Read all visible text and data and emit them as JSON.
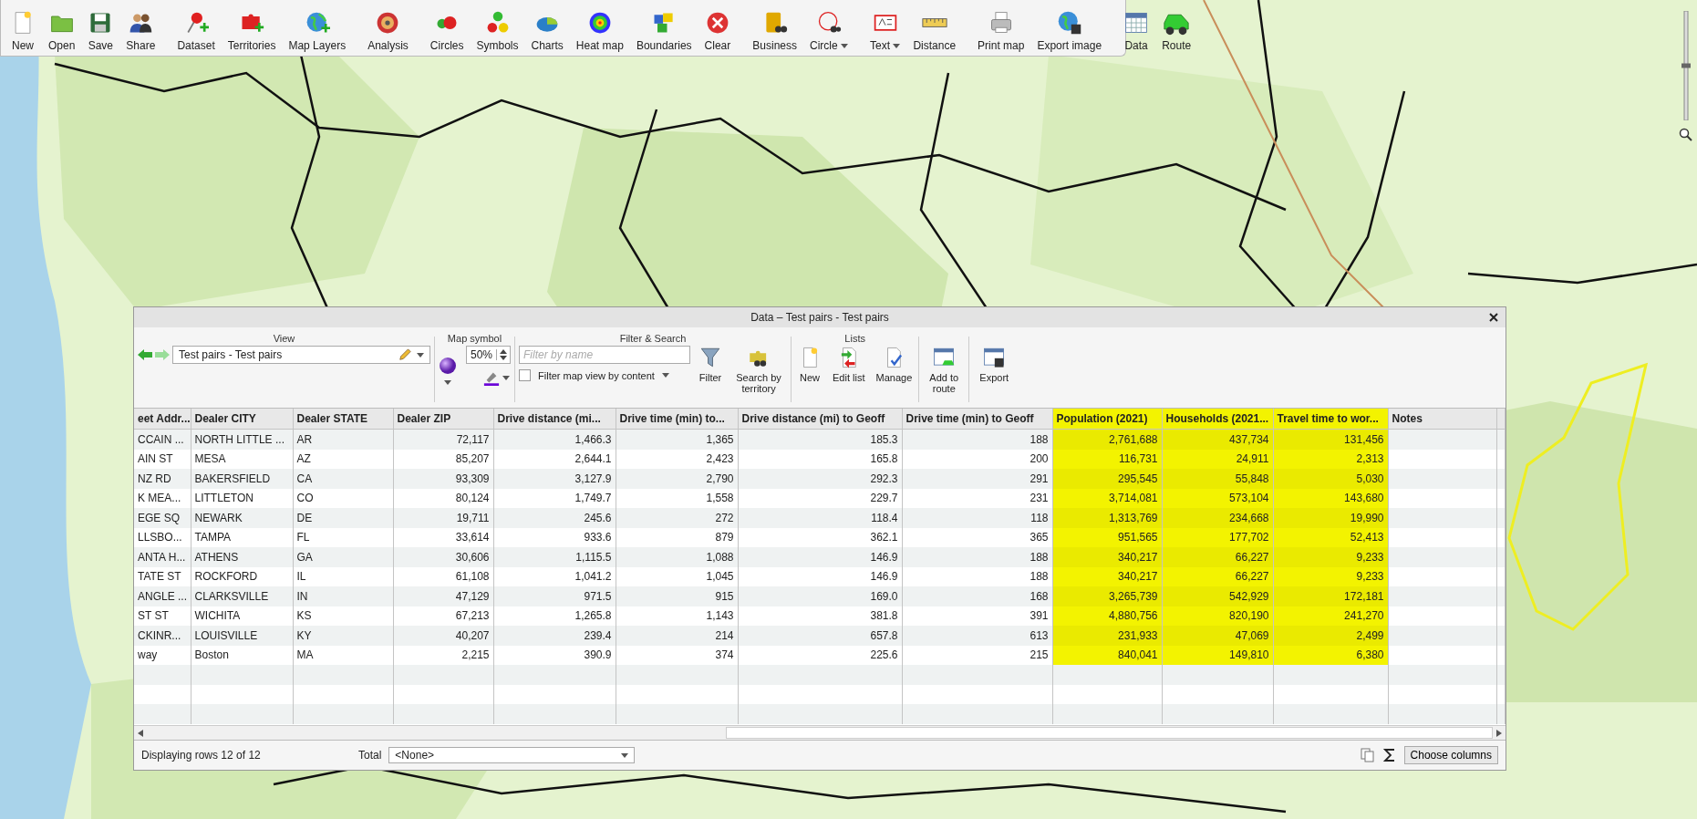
{
  "toolbar": {
    "groups": [
      {
        "buttons": [
          {
            "label": "New",
            "has_menu": false
          },
          {
            "label": "Open",
            "has_menu": false
          },
          {
            "label": "Save",
            "has_menu": false
          },
          {
            "label": "Share",
            "has_menu": false
          }
        ]
      },
      {
        "buttons": [
          {
            "label": "Dataset",
            "has_menu": false
          },
          {
            "label": "Territories",
            "has_menu": false
          },
          {
            "label": "Map Layers",
            "has_menu": false
          }
        ]
      },
      {
        "buttons": [
          {
            "label": "Analysis",
            "has_menu": false
          }
        ]
      },
      {
        "buttons": [
          {
            "label": "Circles",
            "has_menu": false
          },
          {
            "label": "Symbols",
            "has_menu": false
          },
          {
            "label": "Charts",
            "has_menu": false
          },
          {
            "label": "Heat map",
            "has_menu": false
          },
          {
            "label": "Boundaries",
            "has_menu": false
          },
          {
            "label": "Clear",
            "has_menu": false
          }
        ]
      },
      {
        "buttons": [
          {
            "label": "Business",
            "has_menu": false
          },
          {
            "label": "Circle",
            "has_menu": true
          }
        ]
      },
      {
        "buttons": [
          {
            "label": "Text",
            "has_menu": true
          },
          {
            "label": "Distance",
            "has_menu": false
          }
        ]
      },
      {
        "buttons": [
          {
            "label": "Print map",
            "has_menu": false
          },
          {
            "label": "Export image",
            "has_menu": false
          }
        ]
      },
      {
        "buttons": [
          {
            "label": "Data",
            "has_menu": false
          },
          {
            "label": "Route",
            "has_menu": false
          }
        ]
      }
    ]
  },
  "map_zoom": {
    "level": 0.5
  },
  "data_window": {
    "title": "Data – Test pairs - Test pairs",
    "view": {
      "title": "View",
      "value": "Test pairs - Test pairs"
    },
    "map_symbol": {
      "title": "Map symbol",
      "size": "50%"
    },
    "filter_search": {
      "title": "Filter & Search",
      "placeholder": "Filter by name",
      "filter_map_view": {
        "label": "Filter map view by content",
        "checked": false
      },
      "buttons": [
        "Filter",
        "Search by territory"
      ]
    },
    "lists": {
      "title": "Lists",
      "buttons": [
        "New",
        "Edit list",
        "Manage"
      ]
    },
    "buttons": [
      "Add to route",
      "Export"
    ],
    "table": {
      "columns": [
        {
          "label": "eet Addr...",
          "highlighted": false
        },
        {
          "label": "Dealer CITY",
          "highlighted": false
        },
        {
          "label": "Dealer STATE",
          "highlighted": false
        },
        {
          "label": "Dealer ZIP",
          "highlighted": false
        },
        {
          "label": "Drive distance (mi...",
          "highlighted": false
        },
        {
          "label": "Drive time (min) to...",
          "highlighted": false
        },
        {
          "label": "Drive distance (mi) to Geoff",
          "highlighted": false
        },
        {
          "label": "Drive time (min) to Geoff",
          "highlighted": false
        },
        {
          "label": "Population (2021)",
          "highlighted": true
        },
        {
          "label": "Households (2021...",
          "highlighted": true
        },
        {
          "label": "Travel time to wor...",
          "highlighted": true
        },
        {
          "label": "Notes",
          "highlighted": false
        }
      ],
      "rows": [
        [
          "CCAIN ...",
          "NORTH LITTLE ...",
          "AR",
          "72,117",
          "1,466.3",
          "1,365",
          "185.3",
          "188",
          "2,761,688",
          "437,734",
          "131,456"
        ],
        [
          "AIN ST",
          "MESA",
          "AZ",
          "85,207",
          "2,644.1",
          "2,423",
          "165.8",
          "200",
          "116,731",
          "24,911",
          "2,313"
        ],
        [
          "NZ RD",
          "BAKERSFIELD",
          "CA",
          "93,309",
          "3,127.9",
          "2,790",
          "292.3",
          "291",
          "295,545",
          "55,848",
          "5,030"
        ],
        [
          "K MEA...",
          "LITTLETON",
          "CO",
          "80,124",
          "1,749.7",
          "1,558",
          "229.7",
          "231",
          "3,714,081",
          "573,104",
          "143,680"
        ],
        [
          "EGE SQ",
          "NEWARK",
          "DE",
          "19,711",
          "245.6",
          "272",
          "118.4",
          "118",
          "1,313,769",
          "234,668",
          "19,990"
        ],
        [
          "LLSBO...",
          "TAMPA",
          "FL",
          "33,614",
          "933.6",
          "879",
          "362.1",
          "365",
          "951,565",
          "177,702",
          "52,413"
        ],
        [
          "ANTA H...",
          "ATHENS",
          "GA",
          "30,606",
          "1,115.5",
          "1,088",
          "146.9",
          "188",
          "340,217",
          "66,227",
          "9,233"
        ],
        [
          "TATE ST",
          "ROCKFORD",
          "IL",
          "61,108",
          "1,041.2",
          "1,045",
          "146.9",
          "188",
          "340,217",
          "66,227",
          "9,233"
        ],
        [
          "ANGLE ...",
          "CLARKSVILLE",
          "IN",
          "47,129",
          "971.5",
          "915",
          "169.0",
          "168",
          "3,265,739",
          "542,929",
          "172,181"
        ],
        [
          "ST ST",
          "WICHITA",
          "KS",
          "67,213",
          "1,265.8",
          "1,143",
          "381.8",
          "391",
          "4,880,756",
          "820,190",
          "241,270"
        ],
        [
          "CKINR...",
          "LOUISVILLE",
          "KY",
          "40,207",
          "239.4",
          "214",
          "657.8",
          "613",
          "231,933",
          "47,069",
          "2,499"
        ],
        [
          "way",
          "Boston",
          "MA",
          "2,215",
          "390.9",
          "374",
          "225.6",
          "215",
          "840,041",
          "149,810",
          "6,380"
        ]
      ]
    },
    "status": "Displaying rows 12 of 12",
    "total": {
      "label": "Total",
      "value": "<None>"
    },
    "choose_columns": "Choose columns"
  }
}
